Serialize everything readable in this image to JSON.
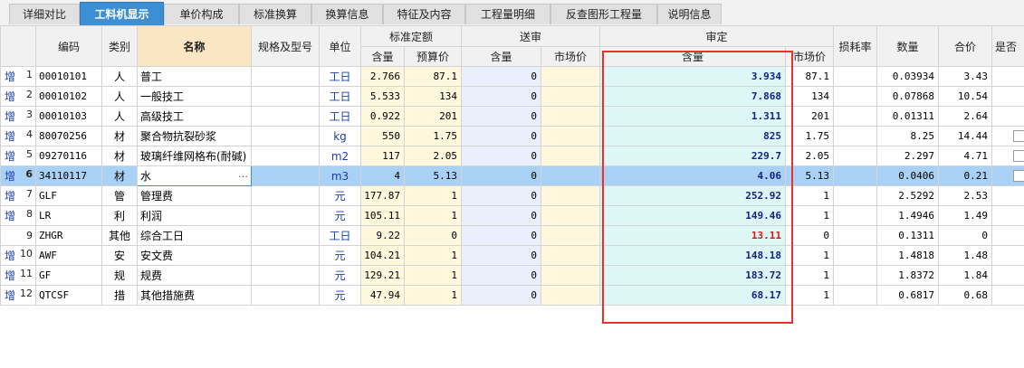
{
  "tabs": [
    "详细对比",
    "工料机显示",
    "单价构成",
    "标准换算",
    "换算信息",
    "特征及内容",
    "工程量明细",
    "反查图形工程量",
    "说明信息"
  ],
  "active_tab_index": 1,
  "header": {
    "code": "编码",
    "category": "类别",
    "name": "名称",
    "spec": "规格及型号",
    "unit": "单位",
    "std_quota": "标准定额",
    "std_amount": "含量",
    "budget_price": "预算价",
    "submitted": "送审",
    "sub_amount": "含量",
    "sub_market": "市场价",
    "approved": "审定",
    "app_amount": "含量",
    "app_market": "市场价",
    "loss_rate": "损耗率",
    "quantity": "数量",
    "total": "合价",
    "is_other": "是否"
  },
  "rows": [
    {
      "add": "增",
      "no": "1",
      "code": "00010101",
      "cat": "人",
      "name": "普工",
      "unit": "工日",
      "std_amt": "2.766",
      "budget": "87.1",
      "sub_amt": "0",
      "app_amt": "3.934",
      "market": "87.1",
      "loss": "",
      "qty": "0.03934",
      "total": "3.43",
      "check": false
    },
    {
      "add": "增",
      "no": "2",
      "code": "00010102",
      "cat": "人",
      "name": "一般技工",
      "unit": "工日",
      "std_amt": "5.533",
      "budget": "134",
      "sub_amt": "0",
      "app_amt": "7.868",
      "market": "134",
      "loss": "",
      "qty": "0.07868",
      "total": "10.54",
      "check": false
    },
    {
      "add": "增",
      "no": "3",
      "code": "00010103",
      "cat": "人",
      "name": "高级技工",
      "unit": "工日",
      "std_amt": "0.922",
      "budget": "201",
      "sub_amt": "0",
      "app_amt": "1.311",
      "market": "201",
      "loss": "",
      "qty": "0.01311",
      "total": "2.64",
      "check": false
    },
    {
      "add": "增",
      "no": "4",
      "code": "80070256",
      "cat": "材",
      "name": "聚合物抗裂砂浆",
      "unit": "kg",
      "std_amt": "550",
      "budget": "1.75",
      "sub_amt": "0",
      "app_amt": "825",
      "market": "1.75",
      "loss": "",
      "qty": "8.25",
      "total": "14.44",
      "check": true
    },
    {
      "add": "增",
      "no": "5",
      "code": "09270116",
      "cat": "材",
      "name": "玻璃纤维网格布(耐碱)",
      "unit": "m2",
      "std_amt": "117",
      "budget": "2.05",
      "sub_amt": "0",
      "app_amt": "229.7",
      "market": "2.05",
      "loss": "",
      "qty": "2.297",
      "total": "4.71",
      "check": true
    },
    {
      "add": "增",
      "no": "6",
      "code": "34110117",
      "cat": "材",
      "name": "水",
      "unit": "m3",
      "std_amt": "4",
      "budget": "5.13",
      "sub_amt": "0",
      "app_amt": "4.06",
      "market": "5.13",
      "loss": "",
      "qty": "0.0406",
      "total": "0.21",
      "check": true,
      "selected": true
    },
    {
      "add": "增",
      "no": "7",
      "code": "GLF",
      "cat": "管",
      "name": "管理费",
      "unit": "元",
      "std_amt": "177.87",
      "budget": "1",
      "sub_amt": "0",
      "app_amt": "252.92",
      "market": "1",
      "loss": "",
      "qty": "2.5292",
      "total": "2.53",
      "check": false
    },
    {
      "add": "增",
      "no": "8",
      "code": "LR",
      "cat": "利",
      "name": "利润",
      "unit": "元",
      "std_amt": "105.11",
      "budget": "1",
      "sub_amt": "0",
      "app_amt": "149.46",
      "market": "1",
      "loss": "",
      "qty": "1.4946",
      "total": "1.49",
      "check": false
    },
    {
      "add": "",
      "no": "9",
      "code": "ZHGR",
      "cat": "其他",
      "name": "综合工日",
      "unit": "工日",
      "std_amt": "9.22",
      "budget": "0",
      "sub_amt": "0",
      "app_amt": "13.11",
      "market": "0",
      "loss": "",
      "qty": "0.1311",
      "total": "0",
      "check": false,
      "red": true
    },
    {
      "add": "增",
      "no": "10",
      "code": "AWF",
      "cat": "安",
      "name": "安文费",
      "unit": "元",
      "std_amt": "104.21",
      "budget": "1",
      "sub_amt": "0",
      "app_amt": "148.18",
      "market": "1",
      "loss": "",
      "qty": "1.4818",
      "total": "1.48",
      "check": false
    },
    {
      "add": "增",
      "no": "11",
      "code": "GF",
      "cat": "规",
      "name": "规费",
      "unit": "元",
      "std_amt": "129.21",
      "budget": "1",
      "sub_amt": "0",
      "app_amt": "183.72",
      "market": "1",
      "loss": "",
      "qty": "1.8372",
      "total": "1.84",
      "check": false
    },
    {
      "add": "增",
      "no": "12",
      "code": "QTCSF",
      "cat": "措",
      "name": "其他措施费",
      "unit": "元",
      "std_amt": "47.94",
      "budget": "1",
      "sub_amt": "0",
      "app_amt": "68.17",
      "market": "1",
      "loss": "",
      "qty": "0.6817",
      "total": "0.68",
      "check": false
    }
  ],
  "colors": {
    "active_tab": "#3d8fd4",
    "name_header": "#fbe6c3",
    "approved_cell": "#ddf7f7",
    "submitted_cell": "#e9f0fb",
    "highlight_box": "#e8322b",
    "selected_row": "#a9d0f5"
  },
  "icons": {
    "ellipsis": "…"
  }
}
